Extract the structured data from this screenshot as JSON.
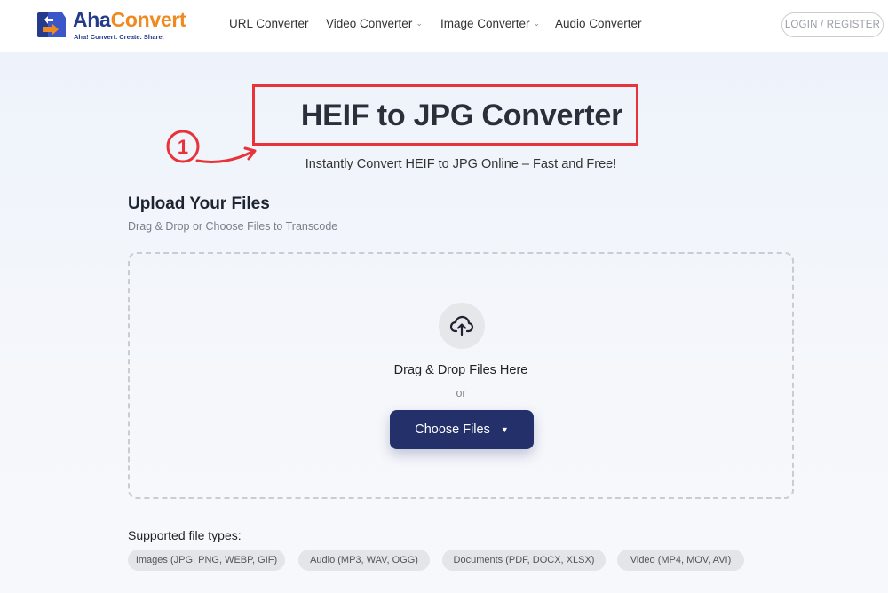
{
  "header": {
    "logo": {
      "name_part1": "Aha",
      "name_part2": "Convert",
      "tagline": "Aha! Convert. Create. Share."
    },
    "nav": [
      {
        "label": "URL Converter",
        "has_dropdown": false
      },
      {
        "label": "Video Converter",
        "has_dropdown": true
      },
      {
        "label": "Image Converter",
        "has_dropdown": true
      },
      {
        "label": "Audio Converter",
        "has_dropdown": false
      }
    ],
    "login_label": "LOGIN / REGISTER"
  },
  "hero": {
    "title": "HEIF to JPG Converter",
    "subtitle": "Instantly Convert HEIF to JPG Online – Fast and Free!",
    "annotation_step": "1"
  },
  "upload": {
    "title": "Upload Your Files",
    "subtitle": "Drag & Drop or Choose Files to Transcode",
    "drop_text": "Drag & Drop Files Here",
    "or_text": "or",
    "choose_label": "Choose Files",
    "icon": "cloud-upload-icon"
  },
  "supported": {
    "label": "Supported file types:",
    "types": [
      "Images (JPG, PNG, WEBP, GIF)",
      "Audio (MP3, WAV, OGG)",
      "Documents (PDF, DOCX, XLSX)",
      "Video (MP4, MOV, AVI)"
    ]
  },
  "colors": {
    "brand_blue": "#243a8c",
    "brand_orange": "#f08a1f",
    "button": "#23306a",
    "annotation_red": "#e8333a"
  }
}
